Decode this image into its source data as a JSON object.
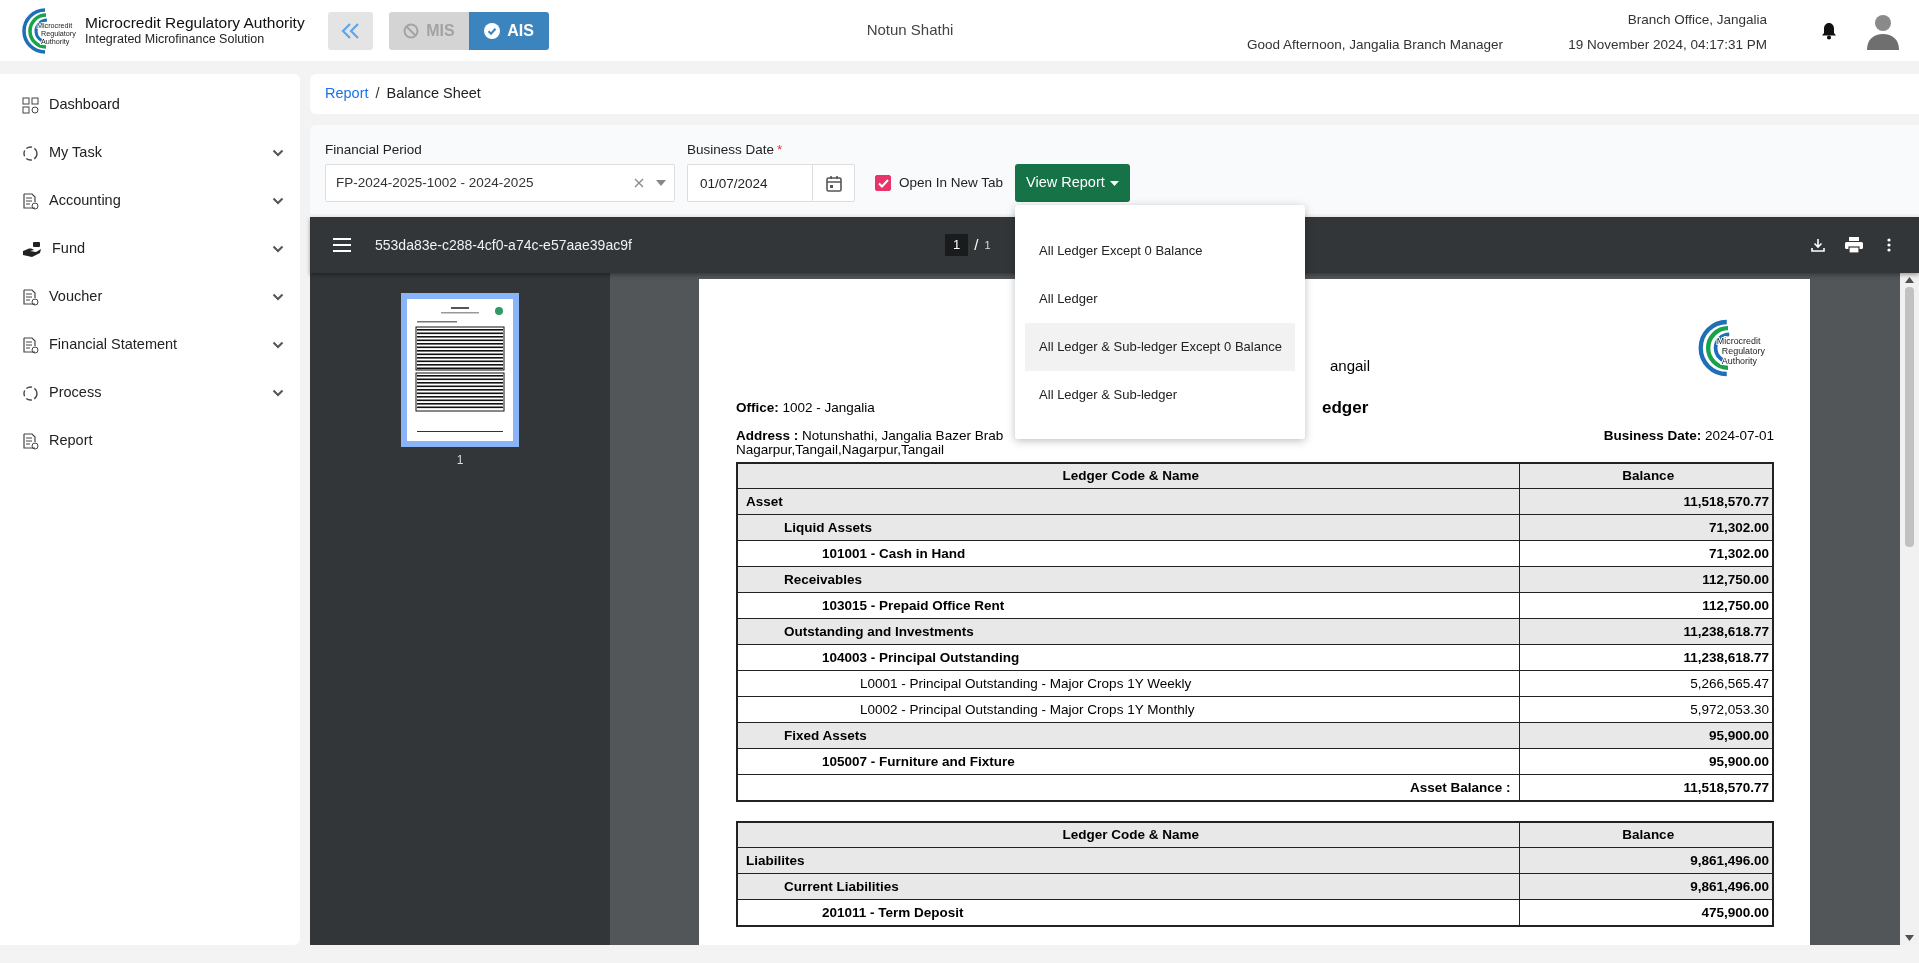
{
  "header": {
    "logo_text": [
      "Microcredit",
      "Regulatory",
      "Authority"
    ],
    "brand_title": "Microcredit Regulatory Authority",
    "brand_subtitle": "Integrated Microfinance Solution",
    "modules": [
      {
        "label": "MIS",
        "selected": false
      },
      {
        "label": "AIS",
        "selected": true
      }
    ],
    "organization": "Notun Shathi",
    "greeting": "Good Afternoon, Jangalia Branch Manager",
    "office": "Branch Office, Jangalia",
    "datetime": "19 November 2024, 04:17:31 PM"
  },
  "sidebar": {
    "items": [
      {
        "label": "Dashboard",
        "kind": "grid",
        "expandable": false
      },
      {
        "label": "My Task",
        "kind": "cycle",
        "expandable": true
      },
      {
        "label": "Accounting",
        "kind": "doc",
        "expandable": true
      },
      {
        "label": "Fund",
        "kind": "hand",
        "expandable": true
      },
      {
        "label": "Voucher",
        "kind": "doc",
        "expandable": true
      },
      {
        "label": "Financial Statement",
        "kind": "doc",
        "expandable": true
      },
      {
        "label": "Process",
        "kind": "cycle",
        "expandable": true
      },
      {
        "label": "Report",
        "kind": "doc",
        "expandable": false
      }
    ]
  },
  "breadcrumb": {
    "separator": "/",
    "items": [
      {
        "label": "Report",
        "kind": "link"
      },
      {
        "label": "Balance Sheet",
        "kind": "current"
      }
    ]
  },
  "filters": {
    "financial_period": {
      "label": "Financial Period",
      "value": "FP-2024-2025-1002 - 2024-2025"
    },
    "business_date": {
      "label": "Business Date",
      "required_mark": "*",
      "value": "01/07/2024"
    },
    "open_in_new_tab": {
      "label": "Open In New Tab",
      "checked": true
    },
    "view_report": {
      "label": "View Report",
      "expanded": true
    }
  },
  "report_menu": {
    "items": [
      {
        "label": "All Ledger Except 0 Balance",
        "selected": false
      },
      {
        "label": "All Ledger",
        "selected": false
      },
      {
        "label": "All Ledger & Sub-ledger Except 0 Balance",
        "selected": true
      },
      {
        "label": "All Ledger & Sub-ledger",
        "selected": false
      }
    ]
  },
  "pdf_viewer": {
    "file_name": "553da83e-c288-4cf0-a74c-e57aae39ac9f",
    "page": "1",
    "page_separator": "/",
    "page_count": "1",
    "thumbnail_label": "1"
  },
  "report": {
    "logo_text": [
      "Microcredit",
      "Regulatory",
      "Authority"
    ],
    "title_fragment": "angail",
    "subtitle_fragment": "edger",
    "office_label": "Office:",
    "office": "1002 - Jangalia",
    "address_label": "Address :",
    "address": "Notunshathi, Jangalia Bazer Brab",
    "address_line_2": "Nagarpur,Tangail,Nagarpur,Tangail",
    "business_date_label": "Business Date:",
    "business_date": "2024-07-01",
    "tables": [
      {
        "columns": [
          "Ledger Code & Name",
          "Balance"
        ],
        "rows": [
          {
            "label": "Asset",
            "balance": "11,518,570.77",
            "children": [
              {
                "label": "Liquid Assets",
                "balance": "71,302.00",
                "children": [
                  {
                    "label": "101001 - Cash in Hand",
                    "balance": "71,302.00"
                  }
                ]
              },
              {
                "label": "Receivables",
                "balance": "112,750.00",
                "children": [
                  {
                    "label": "103015 - Prepaid Office Rent",
                    "balance": "112,750.00"
                  }
                ]
              },
              {
                "label": "Outstanding and Investments",
                "balance": "11,238,618.77",
                "children": [
                  {
                    "label": "104003 - Principal Outstanding",
                    "balance": "11,238,618.77",
                    "children": [
                      {
                        "label": "L0001 - Principal Outstanding - Major Crops 1Y Weekly",
                        "balance": "5,266,565.47"
                      },
                      {
                        "label": "L0002 - Principal Outstanding - Major Crops 1Y Monthly",
                        "balance": "5,972,053.30"
                      }
                    ]
                  }
                ]
              },
              {
                "label": "Fixed Assets",
                "balance": "95,900.00",
                "children": [
                  {
                    "label": "105007 - Furniture and Fixture",
                    "balance": "95,900.00"
                  }
                ]
              }
            ]
          }
        ],
        "total": {
          "label": "Asset Balance :",
          "balance": "11,518,570.77"
        }
      },
      {
        "columns": [
          "Ledger Code & Name",
          "Balance"
        ],
        "rows": [
          {
            "label": "Liabilites",
            "balance": "9,861,496.00",
            "children": [
              {
                "label": "Current Liabilities",
                "balance": "9,861,496.00",
                "children": [
                  {
                    "label": "201011 - Term Deposit",
                    "balance": "475,900.00"
                  }
                ]
              }
            ]
          }
        ]
      }
    ]
  }
}
